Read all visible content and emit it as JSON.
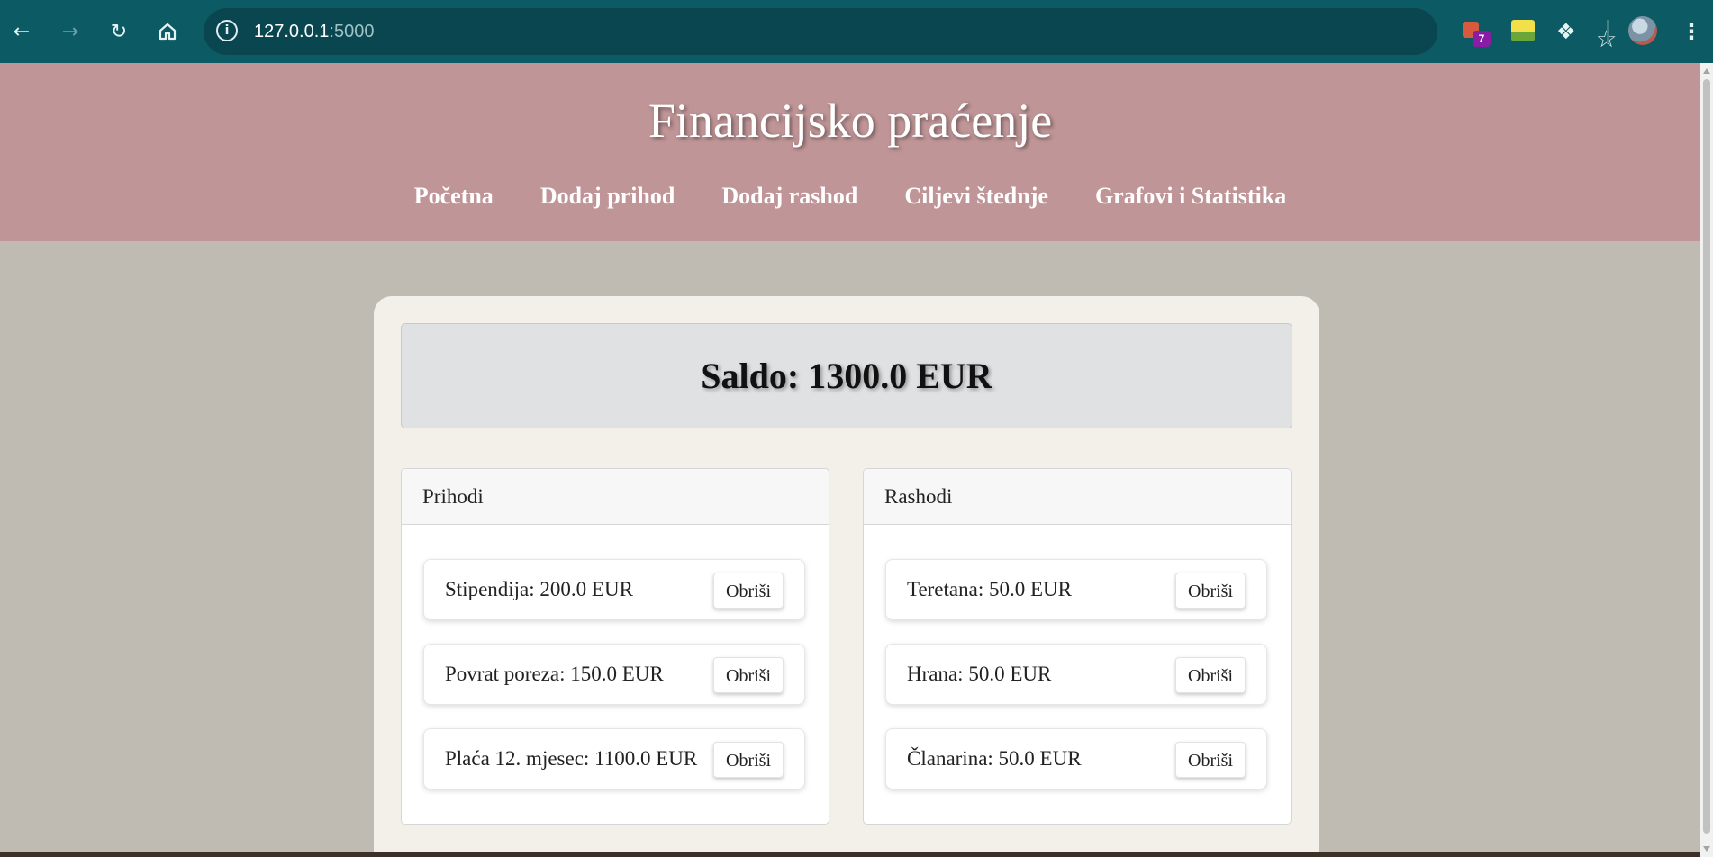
{
  "browser": {
    "url_host": "127.0.0.1",
    "url_port": ":5000",
    "extension_badge": "7"
  },
  "header": {
    "title": "Financijsko praćenje",
    "nav": [
      "Početna",
      "Dodaj prihod",
      "Dodaj rashod",
      "Ciljevi štednje",
      "Grafovi i Statistika"
    ]
  },
  "balance": {
    "text": "Saldo: 1300.0 EUR"
  },
  "income": {
    "heading": "Prihodi",
    "items": [
      {
        "text": "Stipendija: 200.0 EUR",
        "button": "Obriši"
      },
      {
        "text": "Povrat poreza: 150.0 EUR",
        "button": "Obriši"
      },
      {
        "text": "Plaća 12. mjesec: 1100.0 EUR",
        "button": "Obriši"
      }
    ]
  },
  "expenses": {
    "heading": "Rashodi",
    "items": [
      {
        "text": "Teretana: 50.0 EUR",
        "button": "Obriši"
      },
      {
        "text": "Hrana: 50.0 EUR",
        "button": "Obriši"
      },
      {
        "text": "Članarina: 50.0 EUR",
        "button": "Obriši"
      }
    ]
  },
  "colors": {
    "chrome": "#0c5a63",
    "header": "#bf9597",
    "page_bg": "#bfbbb3",
    "card_bg": "#f2f0e9",
    "balance_bg": "#e0e1e3"
  }
}
